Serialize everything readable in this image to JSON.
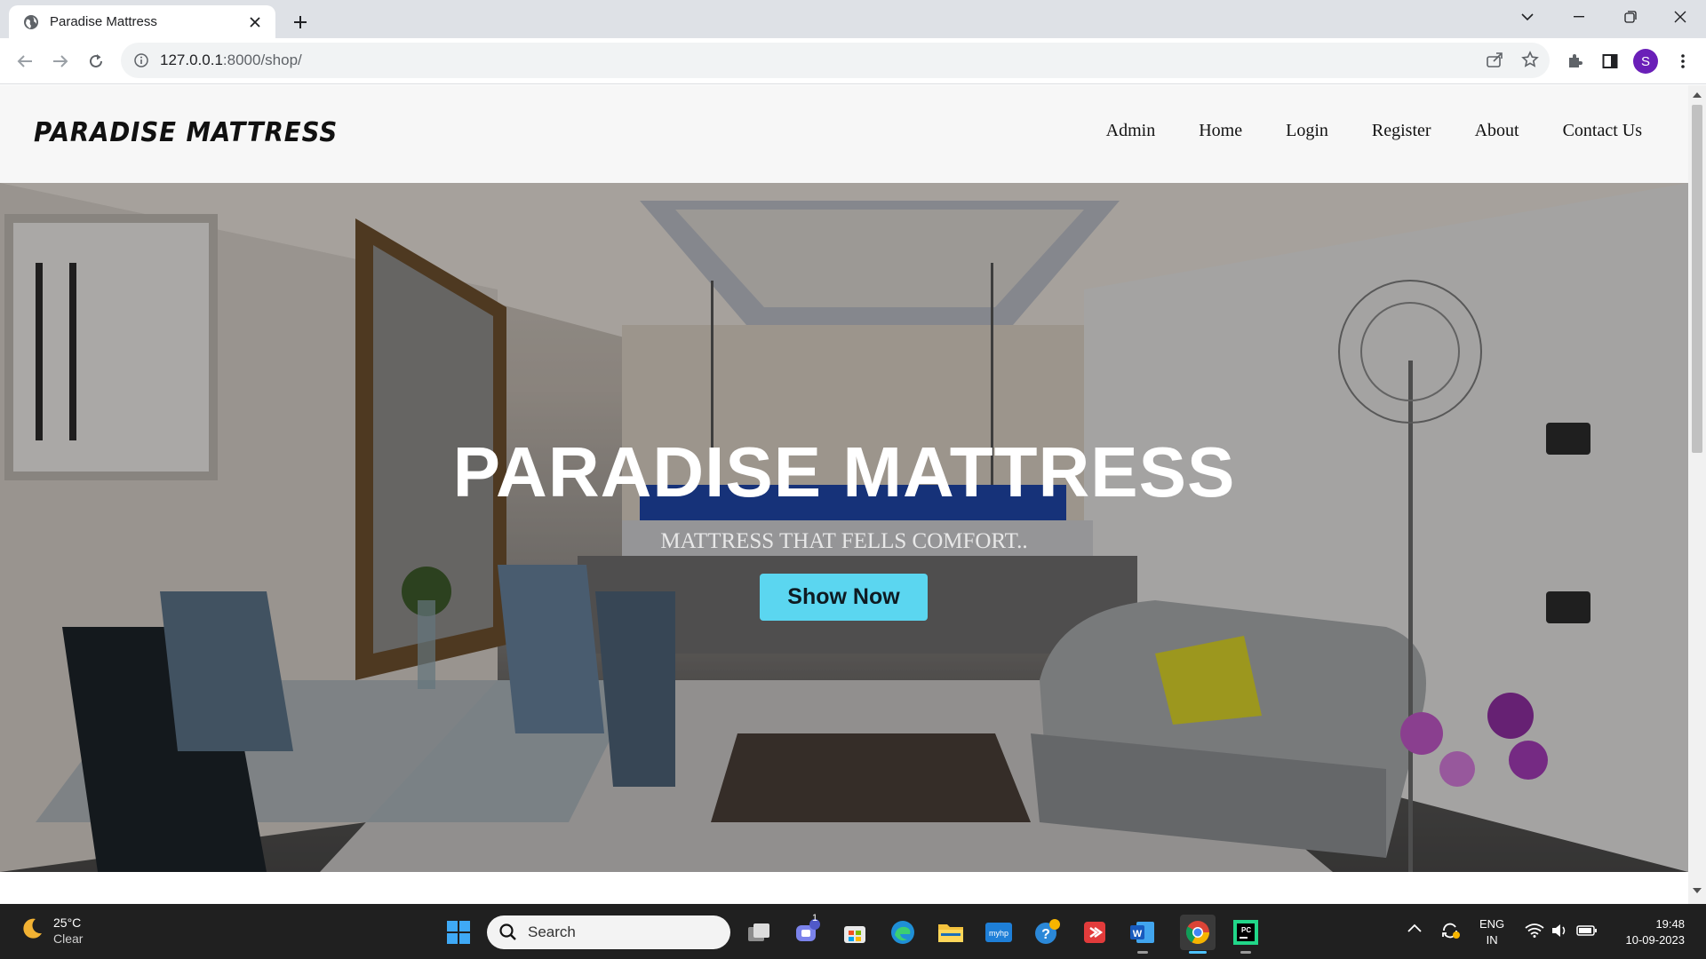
{
  "browser": {
    "tab_title": "Paradise Mattress",
    "url_host": "127.0.0.1",
    "url_rest": ":8000/shop/",
    "profile_initial": "S"
  },
  "site": {
    "brand": "PARADISE MATTRESS",
    "nav": [
      "Admin",
      "Home",
      "Login",
      "Register",
      "About",
      "Contact Us"
    ],
    "hero_title": "PARADISE MATTRESS",
    "hero_subtitle": "MATTRESS THAT FELLS COMFORT..",
    "hero_button": "Show Now",
    "accent_color": "#5bd6f0"
  },
  "taskbar": {
    "weather_temp": "25°C",
    "weather_cond": "Clear",
    "search_placeholder": "Search",
    "teams_badge": "1",
    "lang_line1": "ENG",
    "lang_line2": "IN",
    "time": "19:48",
    "date": "10-09-2023"
  }
}
